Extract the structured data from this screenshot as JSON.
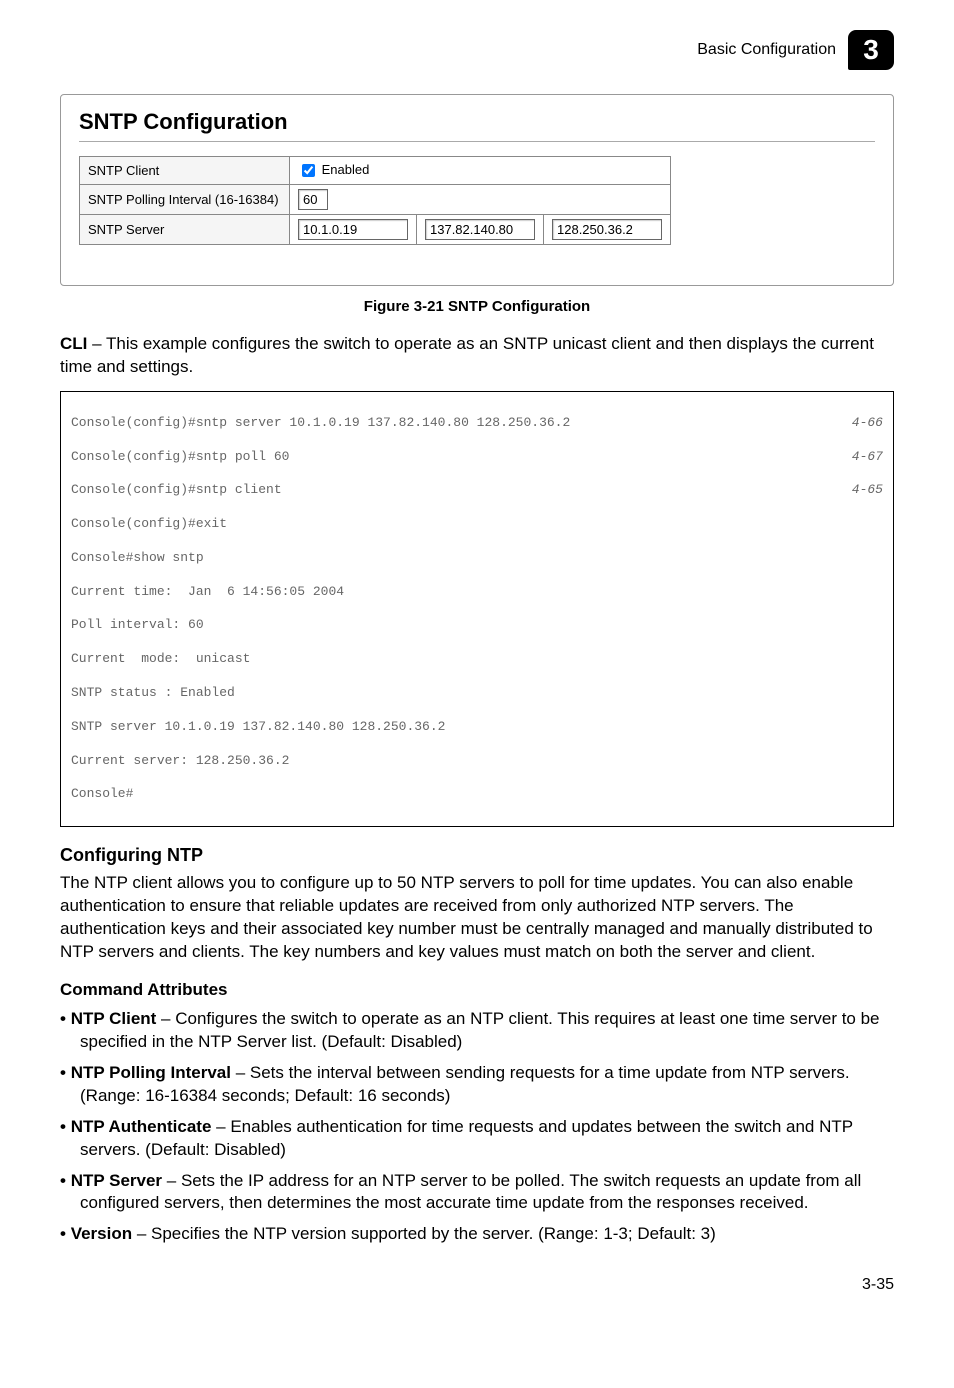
{
  "header": {
    "section": "Basic Configuration",
    "chapter": "3"
  },
  "panel": {
    "title": "SNTP Configuration",
    "rows": {
      "client_label": "SNTP Client",
      "client_enabled_text": " Enabled",
      "polling_label": "SNTP Polling Interval (16-16384)",
      "polling_value": "60",
      "server_label": "SNTP Server",
      "server_values": [
        "10.1.0.19",
        "137.82.140.80",
        "128.250.36.2"
      ]
    }
  },
  "figure_caption": "Figure 3-21  SNTP Configuration",
  "cli_intro_bold": "CLI",
  "cli_intro_rest": " – This example configures the switch to operate as an SNTP unicast client and then displays the current time and settings.",
  "code": {
    "l1": "Console(config)#sntp server 10.1.0.19 137.82.140.80 128.250.36.2",
    "r1": "4-66",
    "l2": "Console(config)#sntp poll 60",
    "r2": "4-67",
    "l3": "Console(config)#sntp client",
    "r3": "4-65",
    "l4": "Console(config)#exit",
    "l5": "Console#show sntp",
    "l6": "Current time:  Jan  6 14:56:05 2004",
    "l7": "Poll interval: 60",
    "l8": "Current  mode:  unicast",
    "l9": "SNTP status : Enabled",
    "l10": "SNTP server 10.1.0.19 137.82.140.80 128.250.36.2",
    "l11": "Current server: 128.250.36.2",
    "l12": "Console#"
  },
  "ntp": {
    "heading": "Configuring NTP",
    "para": "The NTP client allows you to configure up to 50 NTP servers to poll for time updates. You can also enable authentication to ensure that reliable updates are received from only authorized NTP servers. The authentication keys and their associated key number must be centrally managed and manually distributed to NTP servers and clients. The key numbers and key values must match on both the server and client.",
    "attr_heading": "Command Attributes",
    "items": [
      {
        "term": "NTP Client",
        "desc": " – Configures the switch to operate as an NTP client. This requires at least one time server to be specified in the NTP Server list. (Default: Disabled)"
      },
      {
        "term": "NTP Polling Interval",
        "desc": " – Sets the interval between sending requests for a time update from NTP servers. (Range: 16-16384 seconds; Default: 16 seconds)"
      },
      {
        "term": "NTP Authenticate",
        "desc": " – Enables authentication for time requests and updates between the switch and NTP servers. (Default: Disabled)"
      },
      {
        "term": "NTP Server",
        "desc": " – Sets the IP address for an NTP server to be polled. The switch requests an update from all configured servers, then determines the most accurate time update from the responses received."
      },
      {
        "term": "Version",
        "desc": " – Specifies the NTP version supported by the server. (Range: 1-3; Default: 3)"
      }
    ]
  },
  "page_number": "3-35"
}
